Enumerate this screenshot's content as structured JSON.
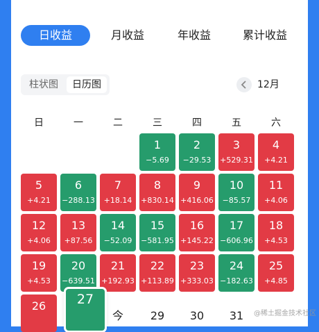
{
  "tabs": [
    {
      "label": "日收益",
      "active": true
    },
    {
      "label": "月收益",
      "active": false
    },
    {
      "label": "年收益",
      "active": false
    },
    {
      "label": "累计收益",
      "active": false
    }
  ],
  "view_toggle": [
    {
      "label": "柱状图",
      "active": false
    },
    {
      "label": "日历图",
      "active": true
    }
  ],
  "month": "12月",
  "weekdays": [
    "日",
    "一",
    "二",
    "三",
    "四",
    "五",
    "六"
  ],
  "colors": {
    "gain": "#e23b45",
    "loss": "#269c6c",
    "accent": "#2f7ff0"
  },
  "days": [
    {
      "day": "1",
      "value": "−5.69",
      "trend": "down"
    },
    {
      "day": "2",
      "value": "−29.53",
      "trend": "down"
    },
    {
      "day": "3",
      "value": "+529.31",
      "trend": "up"
    },
    {
      "day": "4",
      "value": "+4.21",
      "trend": "up"
    },
    {
      "day": "5",
      "value": "+4.21",
      "trend": "up"
    },
    {
      "day": "6",
      "value": "−288.13",
      "trend": "down"
    },
    {
      "day": "7",
      "value": "+18.14",
      "trend": "up"
    },
    {
      "day": "8",
      "value": "+830.14",
      "trend": "up"
    },
    {
      "day": "9",
      "value": "+416.06",
      "trend": "up"
    },
    {
      "day": "10",
      "value": "−85.57",
      "trend": "down"
    },
    {
      "day": "11",
      "value": "+4.06",
      "trend": "up"
    },
    {
      "day": "12",
      "value": "+4.06",
      "trend": "up"
    },
    {
      "day": "13",
      "value": "+87.56",
      "trend": "up"
    },
    {
      "day": "14",
      "value": "−52.09",
      "trend": "down"
    },
    {
      "day": "15",
      "value": "−581.95",
      "trend": "down"
    },
    {
      "day": "16",
      "value": "+145.22",
      "trend": "up"
    },
    {
      "day": "17",
      "value": "−606.96",
      "trend": "down"
    },
    {
      "day": "18",
      "value": "+4.53",
      "trend": "up"
    },
    {
      "day": "19",
      "value": "+4.53",
      "trend": "up"
    },
    {
      "day": "20",
      "value": "−639.51",
      "trend": "down"
    },
    {
      "day": "21",
      "value": "+192.93",
      "trend": "up"
    },
    {
      "day": "22",
      "value": "+113.89",
      "trend": "up"
    },
    {
      "day": "23",
      "value": "+333.03",
      "trend": "up"
    },
    {
      "day": "24",
      "value": "−182.63",
      "trend": "down"
    },
    {
      "day": "25",
      "value": "+4.85",
      "trend": "up"
    },
    {
      "day": "26",
      "value": "",
      "trend": "up"
    },
    {
      "day": "27",
      "value": "",
      "trend": "down",
      "selected": true
    },
    {
      "day": "今",
      "value": "",
      "trend": "none"
    },
    {
      "day": "29",
      "value": "",
      "trend": "none"
    },
    {
      "day": "30",
      "value": "",
      "trend": "none"
    },
    {
      "day": "31",
      "value": "",
      "trend": "none"
    }
  ],
  "watermark": "@稀土掘金技术社区"
}
